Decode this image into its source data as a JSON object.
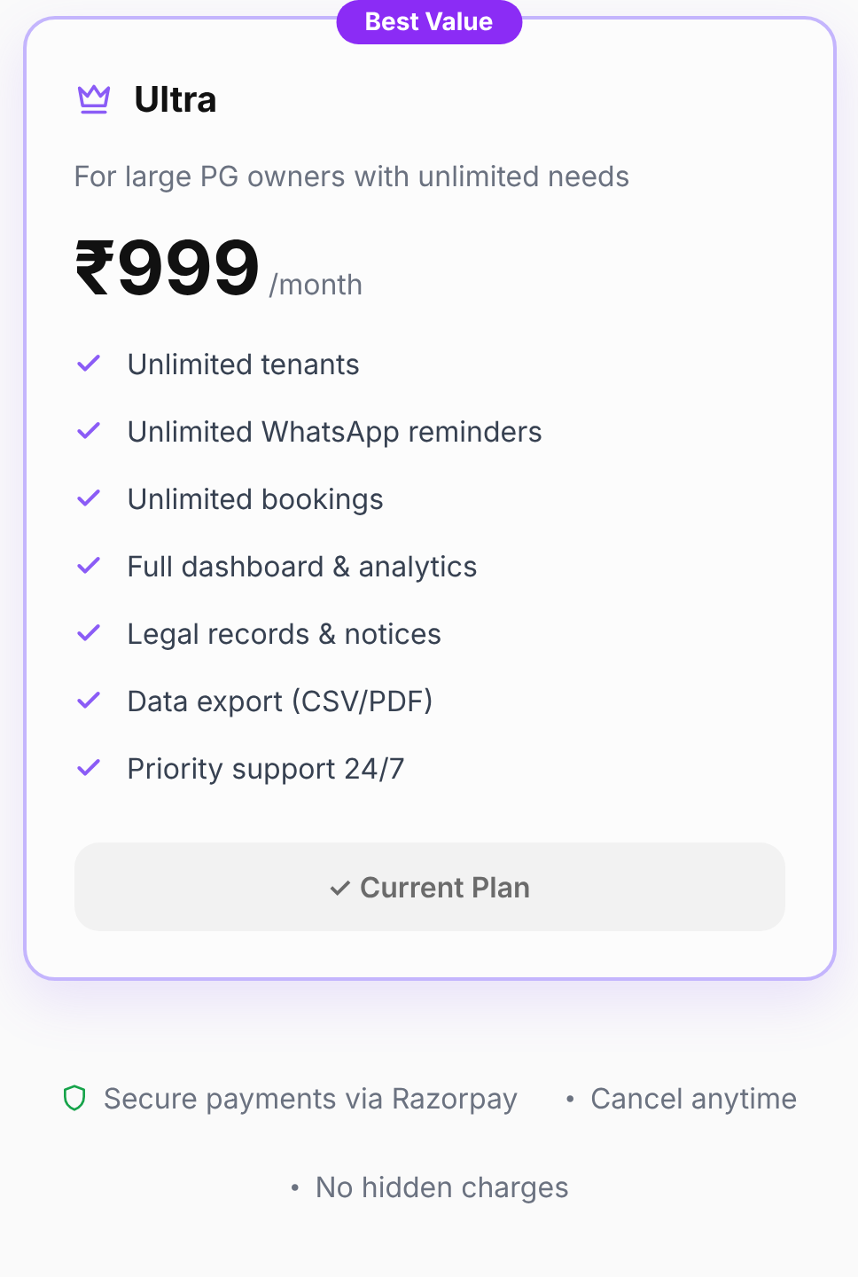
{
  "plan": {
    "badge": "Best Value",
    "name": "Ultra",
    "description": "For large PG owners with unlimited needs",
    "price": "₹999",
    "period": "/month",
    "features": [
      {
        "text": "Unlimited tenants"
      },
      {
        "text": "Unlimited WhatsApp reminders"
      },
      {
        "text": "Unlimited bookings"
      },
      {
        "text": "Full dashboard & analytics"
      },
      {
        "text": "Legal records & notices"
      },
      {
        "text": "Data export (CSV/PDF)"
      },
      {
        "text": "Priority support 24/7"
      }
    ],
    "button": {
      "label": "✓ Current Plan",
      "disabled": true
    }
  },
  "footer": [
    [
      {
        "kind": "shield",
        "text": "Secure payments via Razorpay"
      },
      {
        "kind": "bullet",
        "marker": "•",
        "text": "Cancel anytime"
      }
    ],
    [
      {
        "kind": "bullet",
        "marker": "•",
        "text": "No hidden charges"
      }
    ]
  ]
}
